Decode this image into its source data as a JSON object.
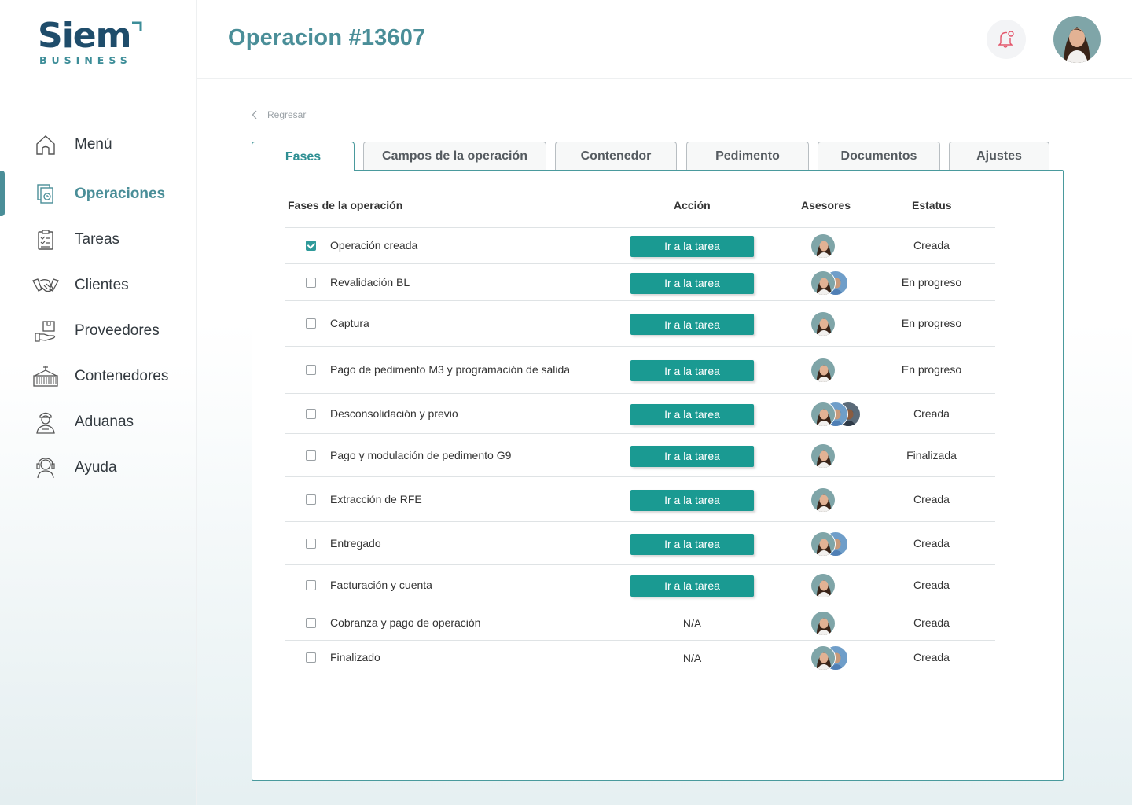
{
  "brand": {
    "name": "Siem",
    "sub": "BUSINESS"
  },
  "colors": {
    "accent": "#4a8e98",
    "button": "#1a9a92",
    "logo": "#1f4d6b",
    "bell": "#e3566b"
  },
  "sidebar": {
    "items": [
      {
        "label": "Menú",
        "icon": "home-icon"
      },
      {
        "label": "Operaciones",
        "icon": "documents-icon",
        "active": true
      },
      {
        "label": "Tareas",
        "icon": "checklist-icon"
      },
      {
        "label": "Clientes",
        "icon": "handshake-icon"
      },
      {
        "label": "Proveedores",
        "icon": "package-hand-icon"
      },
      {
        "label": "Contenedores",
        "icon": "container-icon"
      },
      {
        "label": "Aduanas",
        "icon": "officer-icon"
      },
      {
        "label": "Ayuda",
        "icon": "headset-icon"
      }
    ]
  },
  "header": {
    "title": "Operacion #13607"
  },
  "main": {
    "back_label": "Regresar",
    "tabs": [
      {
        "label": "Fases",
        "active": true
      },
      {
        "label": "Campos de la operación"
      },
      {
        "label": "Contenedor"
      },
      {
        "label": "Pedimento"
      },
      {
        "label": "Documentos"
      },
      {
        "label": "Ajustes"
      }
    ],
    "table": {
      "headers": [
        "Fases de la operación",
        "Acción",
        "Asesores",
        "Estatus"
      ],
      "button_label": "Ir a la tarea",
      "rows": [
        {
          "phase": "Operación creada",
          "checked": true,
          "action": "Ir a la tarea",
          "advisors": 1,
          "status": "Creada"
        },
        {
          "phase": "Revalidación BL",
          "checked": false,
          "action": "Ir a la tarea",
          "advisors": 2,
          "status": "En progreso"
        },
        {
          "phase": "Captura",
          "checked": false,
          "action": "Ir a la tarea",
          "advisors": 1,
          "status": "En progreso"
        },
        {
          "phase": "Pago de pedimento M3 y programación de salida",
          "checked": false,
          "action": "Ir a la tarea",
          "advisors": 1,
          "status": "En progreso"
        },
        {
          "phase": "Desconsolidación y previo",
          "checked": false,
          "action": "Ir a la tarea",
          "advisors": 3,
          "status": "Creada"
        },
        {
          "phase": "Pago y modulación de pedimento G9",
          "checked": false,
          "action": "Ir a la tarea",
          "advisors": 1,
          "status": "Finalizada"
        },
        {
          "phase": "Extracción de RFE",
          "checked": false,
          "action": "Ir a la tarea",
          "advisors": 1,
          "status": "Creada"
        },
        {
          "phase": "Entregado",
          "checked": false,
          "action": "Ir a la tarea",
          "advisors": 2,
          "status": "Creada"
        },
        {
          "phase": "Facturación y cuenta",
          "checked": false,
          "action": "Ir a la tarea",
          "advisors": 1,
          "status": "Creada"
        },
        {
          "phase": "Cobranza y pago de operación",
          "checked": false,
          "action": "N/A",
          "advisors": 1,
          "status": "Creada"
        },
        {
          "phase": "Finalizado",
          "checked": false,
          "action": "N/A",
          "advisors": 2,
          "status": "Creada"
        }
      ]
    }
  }
}
